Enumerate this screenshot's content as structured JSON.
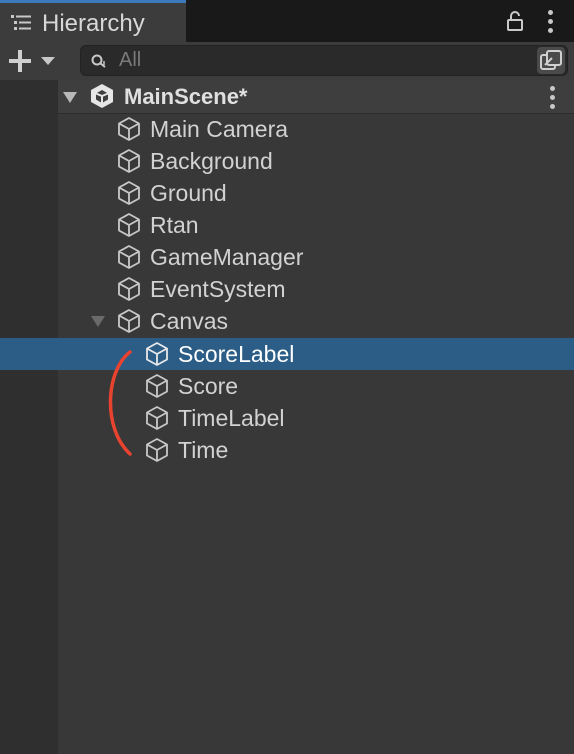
{
  "panel": {
    "title": "Hierarchy",
    "search_placeholder": "All"
  },
  "scene": {
    "name": "MainScene*"
  },
  "items": [
    {
      "label": "Main Camera"
    },
    {
      "label": "Background"
    },
    {
      "label": "Ground"
    },
    {
      "label": "Rtan"
    },
    {
      "label": "GameManager"
    },
    {
      "label": "EventSystem"
    },
    {
      "label": "Canvas"
    },
    {
      "label": "ScoreLabel"
    },
    {
      "label": "Score"
    },
    {
      "label": "TimeLabel"
    },
    {
      "label": "Time"
    }
  ],
  "selected_item": "ScoreLabel",
  "colors": {
    "selection": "#2c5d87",
    "tab_accent": "#3a79bb",
    "annotation": "#e8432f"
  },
  "icons": [
    "hierarchy-list-icon",
    "lock-icon",
    "kebab-menu-icon",
    "plus-icon",
    "dropdown-caret-icon",
    "search-icon",
    "scene-filter-icon",
    "expand-arrow-icon",
    "unity-logo-icon",
    "gameobject-cube-icon"
  ]
}
